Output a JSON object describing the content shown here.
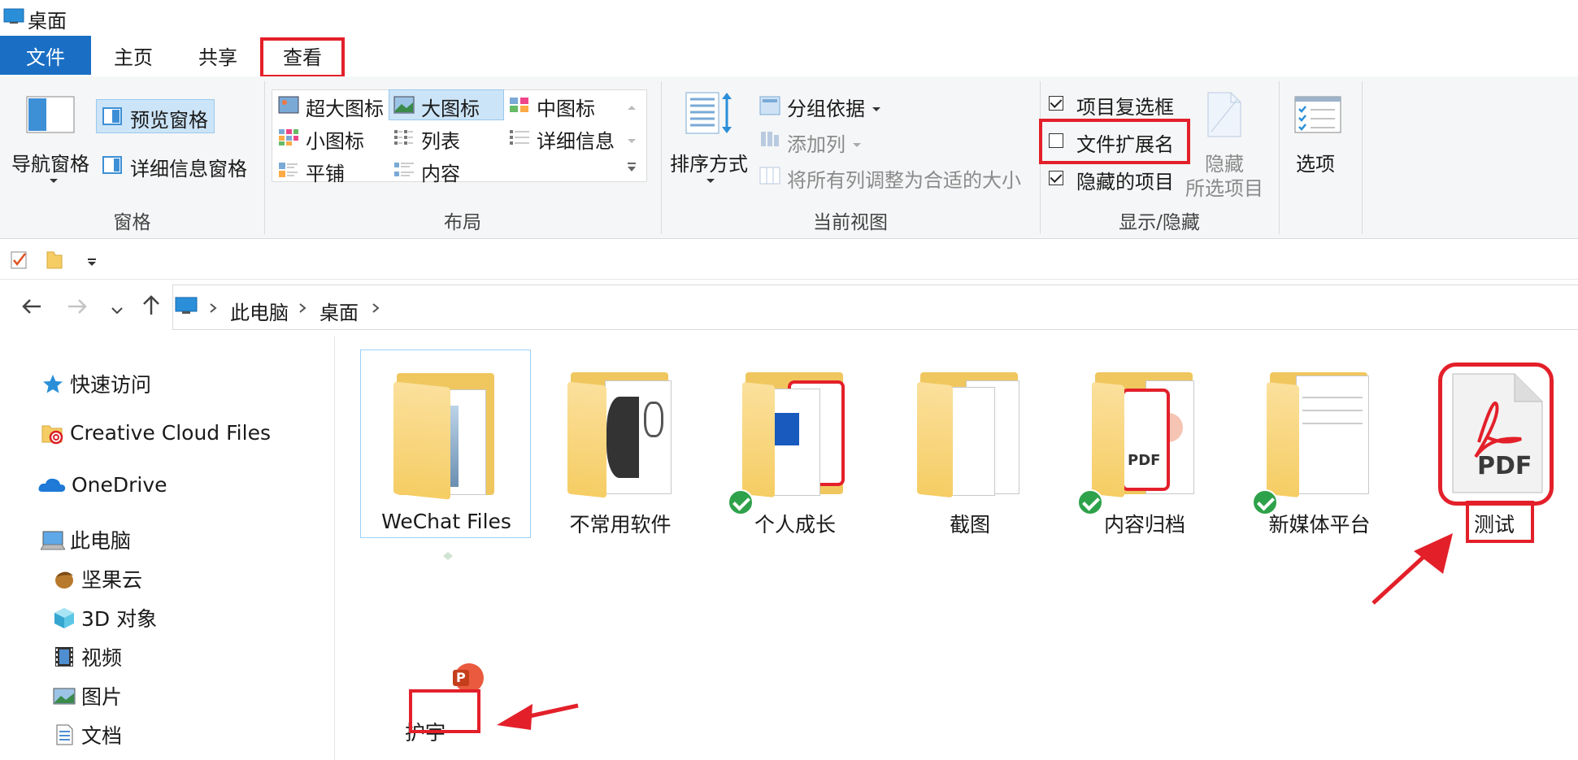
{
  "window": {
    "title": "桌面",
    "icon": "desktop-icon"
  },
  "tabs": [
    {
      "label": "文件",
      "active": true
    },
    {
      "label": "主页"
    },
    {
      "label": "共享"
    },
    {
      "label": "查看",
      "highlighted": true
    }
  ],
  "ribbon": {
    "panes": {
      "nav_pane": "导航窗格",
      "preview_pane": "预览窗格",
      "details_pane": "详细信息窗格",
      "group": "窗格"
    },
    "layout": {
      "options": [
        "超大图标",
        "大图标",
        "中图标",
        "小图标",
        "列表",
        "详细信息",
        "平铺",
        "内容"
      ],
      "selected": "大图标",
      "group": "布局"
    },
    "current_view": {
      "sort": "排序方式",
      "group_by": "分组依据",
      "add_column": "添加列",
      "fit_columns": "将所有列调整为合适的大小",
      "group": "当前视图"
    },
    "show_hide": {
      "item_checkboxes": {
        "label": "项目复选框",
        "checked": true
      },
      "file_extensions": {
        "label": "文件扩展名",
        "checked": false
      },
      "hidden_items": {
        "label": "隐藏的项目",
        "checked": true
      },
      "hide_selected_line1": "隐藏",
      "hide_selected_line2": "所选项目",
      "group": "显示/隐藏"
    },
    "options": "选项"
  },
  "qat": {
    "icons": [
      "checkbox-icon",
      "folder-icon",
      "dropdown-icon"
    ]
  },
  "address": {
    "crumbs": [
      "此电脑",
      "桌面"
    ]
  },
  "nav": {
    "items": [
      {
        "label": "快速访问",
        "icon": "star-icon"
      },
      {
        "label": "Creative Cloud Files",
        "icon": "creative-cloud-folder-icon"
      },
      {
        "label": "OneDrive",
        "icon": "onedrive-cloud-icon"
      },
      {
        "label": "此电脑",
        "icon": "this-pc-icon"
      },
      {
        "label": "坚果云",
        "icon": "nutstore-icon"
      },
      {
        "label": "3D 对象",
        "icon": "3d-objects-icon"
      },
      {
        "label": "视频",
        "icon": "video-icon"
      },
      {
        "label": "图片",
        "icon": "pictures-icon"
      },
      {
        "label": "文档",
        "icon": "documents-icon"
      }
    ]
  },
  "files": [
    {
      "name": "WeChat Files",
      "type": "folder",
      "synced": false,
      "selected": true
    },
    {
      "name": "不常用软件",
      "type": "folder",
      "synced": false
    },
    {
      "name": "个人成长",
      "type": "folder",
      "synced": true
    },
    {
      "name": "截图",
      "type": "folder",
      "synced": false
    },
    {
      "name": "内容归档",
      "type": "folder",
      "synced": true
    },
    {
      "name": "新媒体平台",
      "type": "folder",
      "synced": true
    },
    {
      "name": "测试",
      "type": "pdf",
      "badge": "PDF"
    },
    {
      "name": "护宇",
      "type": "pptx",
      "badge": "P"
    }
  ],
  "colors": {
    "accent": "#1a6fc4",
    "highlight": "#e3202a",
    "folder": "#f6cd64",
    "sync": "#2ea24a"
  }
}
